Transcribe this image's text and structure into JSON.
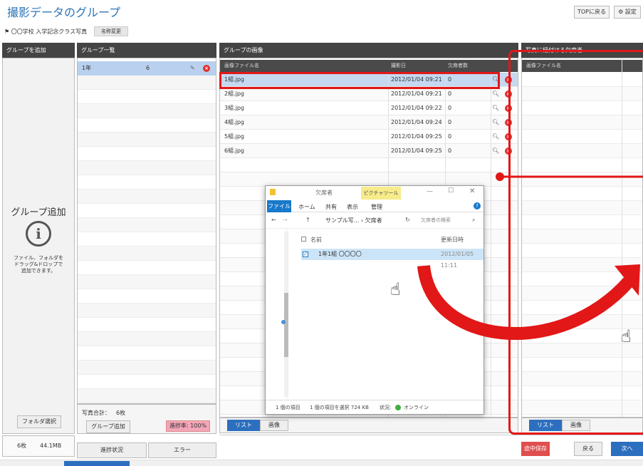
{
  "app": {
    "title": "撮影データのグループ",
    "top_button": "TOPに戻る",
    "settings_button": "設定"
  },
  "school": {
    "name": "〇〇学校 入学記念クラス写真",
    "rename_button": "名称変更"
  },
  "left_panel": {
    "header": "グループを追加",
    "add_title": "グループ追加",
    "hint_lines": [
      "ファイル、フォルダを",
      "ドラッグ&ドロップで",
      "追加できます。"
    ],
    "folder_select_button": "フォルダ選択",
    "count": "6枚",
    "size": "44.1MB"
  },
  "group_panel": {
    "header": "グループ一覧",
    "groups": [
      {
        "name": "1年",
        "count": "6"
      }
    ],
    "total_label": "写真合計：",
    "total_value": "6枚",
    "add_group_button": "グループ追加",
    "progress_badge": "進捗率: 100%",
    "progress_button": "進捗状況",
    "error_button": "エラー"
  },
  "images_panel": {
    "header": "グループの画像",
    "columns": [
      "画像ファイル名",
      "撮影日",
      "欠席者数"
    ],
    "rows": [
      {
        "file": "1組.jpg",
        "date": "2012/01/04 09:21",
        "absent": "0"
      },
      {
        "file": "2組.jpg",
        "date": "2012/01/04 09:21",
        "absent": "0"
      },
      {
        "file": "3組.jpg",
        "date": "2012/01/04 09:22",
        "absent": "0"
      },
      {
        "file": "4組.jpg",
        "date": "2012/01/04 09:24",
        "absent": "0"
      },
      {
        "file": "5組.jpg",
        "date": "2012/01/04 09:25",
        "absent": "0"
      },
      {
        "file": "6組.jpg",
        "date": "2012/01/04 09:25",
        "absent": "0"
      }
    ],
    "list_button": "リスト",
    "image_button": "画像"
  },
  "absent_panel": {
    "header": "写真に紐付ける欠席者",
    "column": "画像ファイル名",
    "list_button": "リスト",
    "image_button": "画像"
  },
  "footer": {
    "save_button": "途中保存",
    "back_button": "戻る",
    "next_button": "次へ"
  },
  "explorer": {
    "title": "欠席者",
    "ribbon_context": "ピクチャツール",
    "tabs": [
      "ファイル",
      "ホーム",
      "共有",
      "表示",
      "管理"
    ],
    "path": "サンプル写... › 欠席者",
    "search_placeholder": "欠席者の検索",
    "col_name": "名前",
    "col_date": "更新日時",
    "item_name": "1年1組 〇〇〇〇",
    "item_date": "2012/01/05 11:11",
    "status_items": "1 個の項目",
    "status_selected": "1 個の項目を選択 724 KB",
    "status_state": "状況:",
    "status_online": "オンライン"
  },
  "colors": {
    "accent": "#2c6fbe",
    "highlight_red": "#e21717",
    "selected_row": "#c5d9f1",
    "header_dark": "#444444"
  }
}
